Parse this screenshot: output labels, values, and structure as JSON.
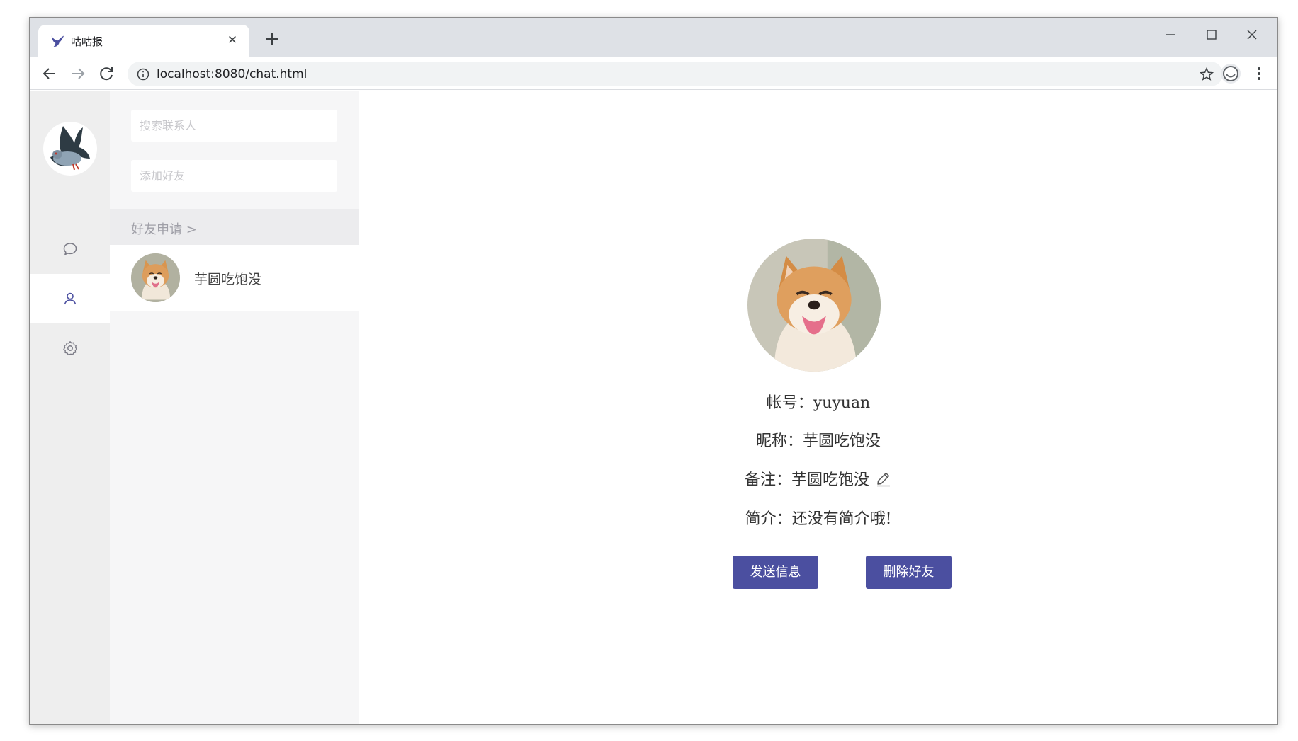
{
  "browser": {
    "tab_title": "咕咕报",
    "tab_close": "✕",
    "url": "localhost:8080/chat.html"
  },
  "sidebar": {
    "search_placeholder": "搜索联系人",
    "add_friend_placeholder": "添加好友",
    "friend_requests_label": "好友申请 >",
    "contacts": [
      {
        "name": "芋圆吃饱没"
      }
    ],
    "rail_icons": [
      "chat-icon",
      "contacts-icon",
      "settings-icon"
    ]
  },
  "profile": {
    "account": "帐号：yuyuan",
    "nickname": "昵称：芋圆吃饱没",
    "remark": "备注：芋圆吃饱没",
    "intro": "简介：还没有简介哦!",
    "send_button": "发送信息",
    "delete_button": "删除好友"
  },
  "colors": {
    "accent": "#4b4fa0",
    "rail_bg": "#eeeeee",
    "panel_bg": "#f6f6f7"
  }
}
